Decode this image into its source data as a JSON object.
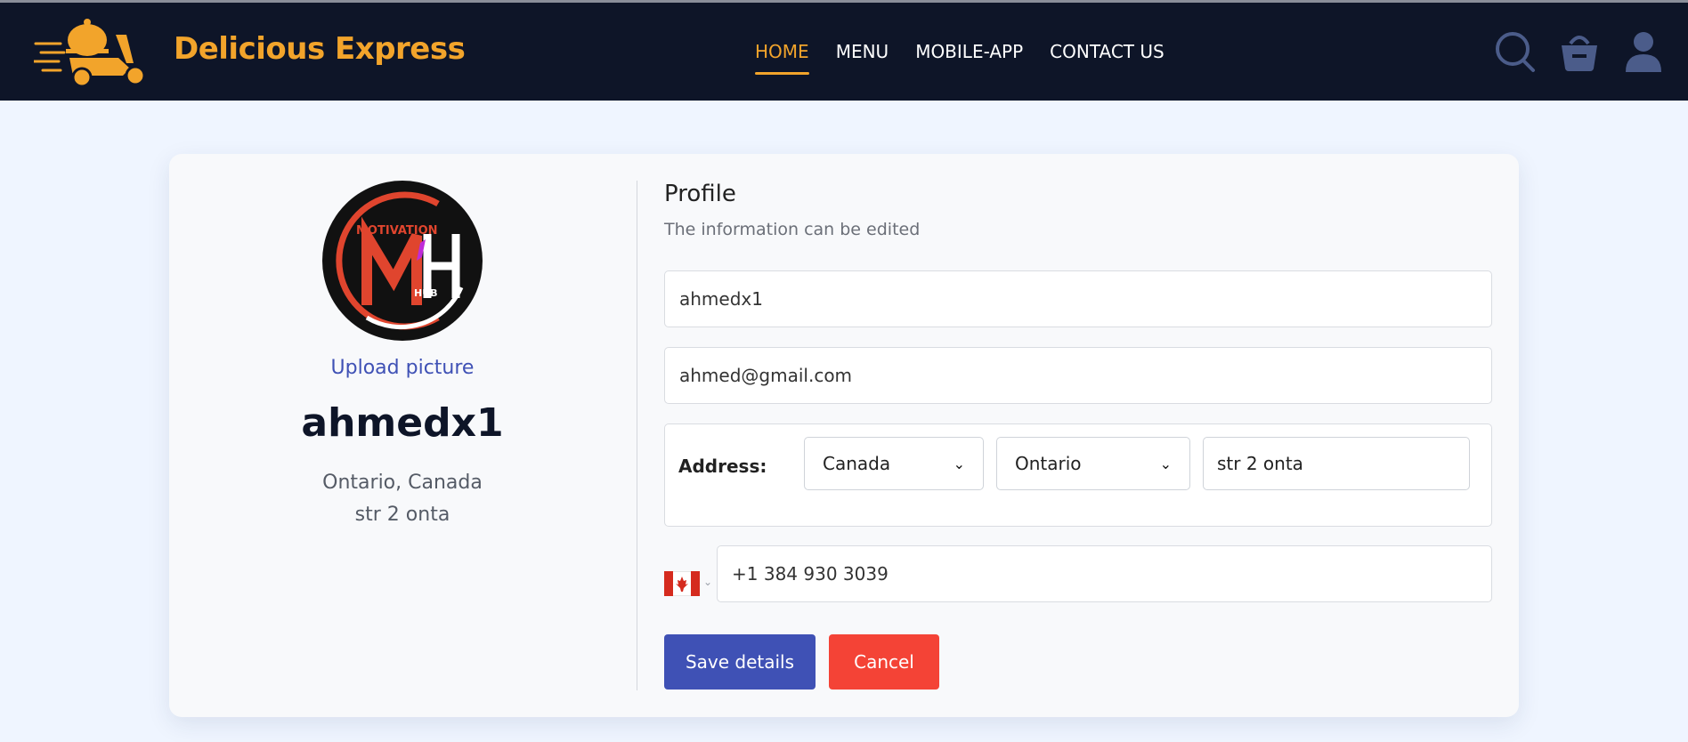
{
  "header": {
    "brand": "Delicious Express",
    "nav": [
      "HOME",
      "MENU",
      "MOBILE-APP",
      "CONTACT US"
    ],
    "active_nav": "HOME",
    "icons": [
      "search-icon",
      "cart-icon",
      "user-icon"
    ]
  },
  "profile_card": {
    "avatar_text": {
      "top": "MOTIVATION",
      "bottom": "HUB"
    },
    "upload_label": "Upload picture",
    "username": "ahmedx1",
    "location_line": "Ontario, Canada",
    "street_line": "str 2 onta"
  },
  "form": {
    "title": "Profile",
    "subtitle": "The information can be edited",
    "username_value": "ahmedx1",
    "email_value": "ahmed@gmail.com",
    "address_label": "Address:",
    "country": "Canada",
    "province": "Ontario",
    "street": "str 2 onta",
    "phone": "+1 384 930 3039",
    "save_label": "Save details",
    "cancel_label": "Cancel"
  },
  "colors": {
    "header_bg": "#0e1528",
    "accent": "#f2a42b",
    "primary": "#3f51b5",
    "danger": "#f44336",
    "page_bg": "#eff5ff"
  }
}
